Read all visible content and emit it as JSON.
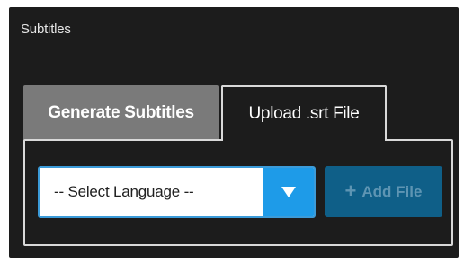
{
  "panel": {
    "title": "Subtitles"
  },
  "tabs": [
    {
      "label": "Generate Subtitles",
      "active": false
    },
    {
      "label": "Upload .srt File",
      "active": true
    }
  ],
  "language_select": {
    "selected": "-- Select Language --",
    "arrow_icon": "triangle-down-icon"
  },
  "add_file": {
    "label": "Add File",
    "icon": "plus-icon",
    "disabled": true
  },
  "colors": {
    "panel_background": "#1c1c1c",
    "inactive_tab": "#7a7a7a",
    "accent_blue": "#1e9be8",
    "add_button": "#0f5f88"
  }
}
